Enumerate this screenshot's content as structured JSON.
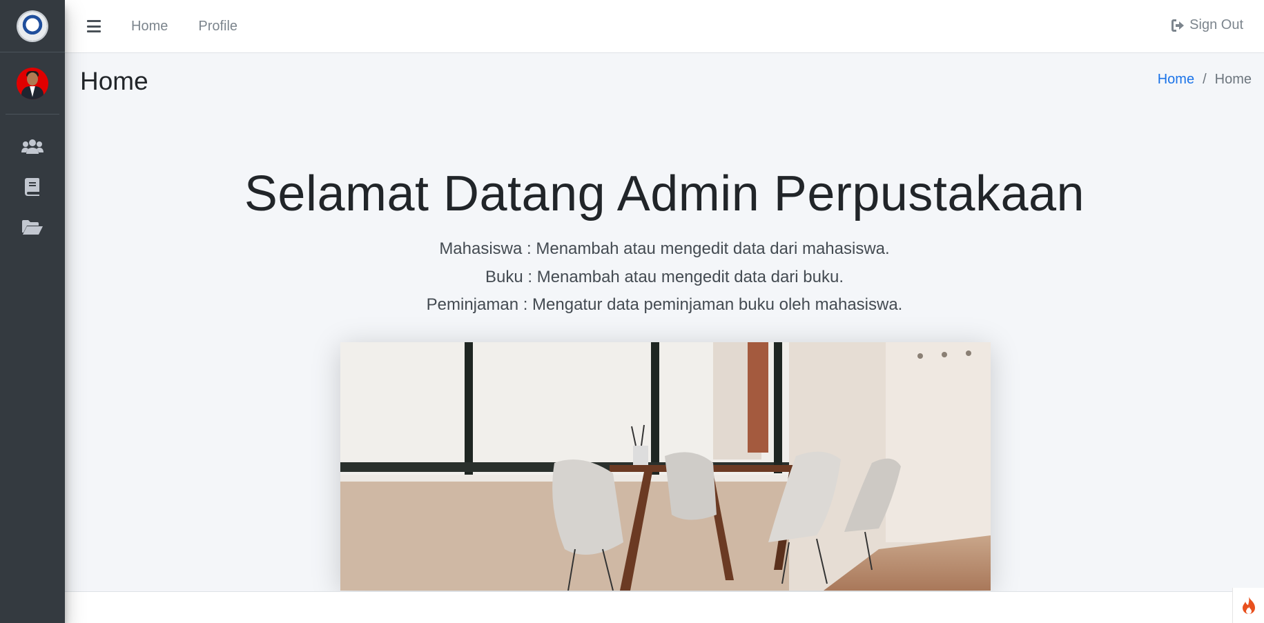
{
  "topbar": {
    "links": [
      "Home",
      "Profile"
    ],
    "signout_label": "Sign Out"
  },
  "sidebar": {
    "items": [
      {
        "icon": "users-icon"
      },
      {
        "icon": "book-icon"
      },
      {
        "icon": "folder-open-icon"
      }
    ]
  },
  "header": {
    "title": "Home",
    "breadcrumb": {
      "link": "Home",
      "separator": "/",
      "active": "Home"
    }
  },
  "main": {
    "welcome": "Selamat Datang Admin Perpustakaan",
    "descriptions": [
      "Mahasiswa : Menambah atau mengedit data dari mahasiswa.",
      "Buku : Menambah atau mengedit data dari buku.",
      "Peminjaman : Mengatur data peminjaman buku oleh mahasiswa."
    ]
  },
  "colors": {
    "sidebar": "#343a40",
    "background": "#f4f6f9",
    "link": "#1a73e8",
    "fire": "#e8501e"
  }
}
